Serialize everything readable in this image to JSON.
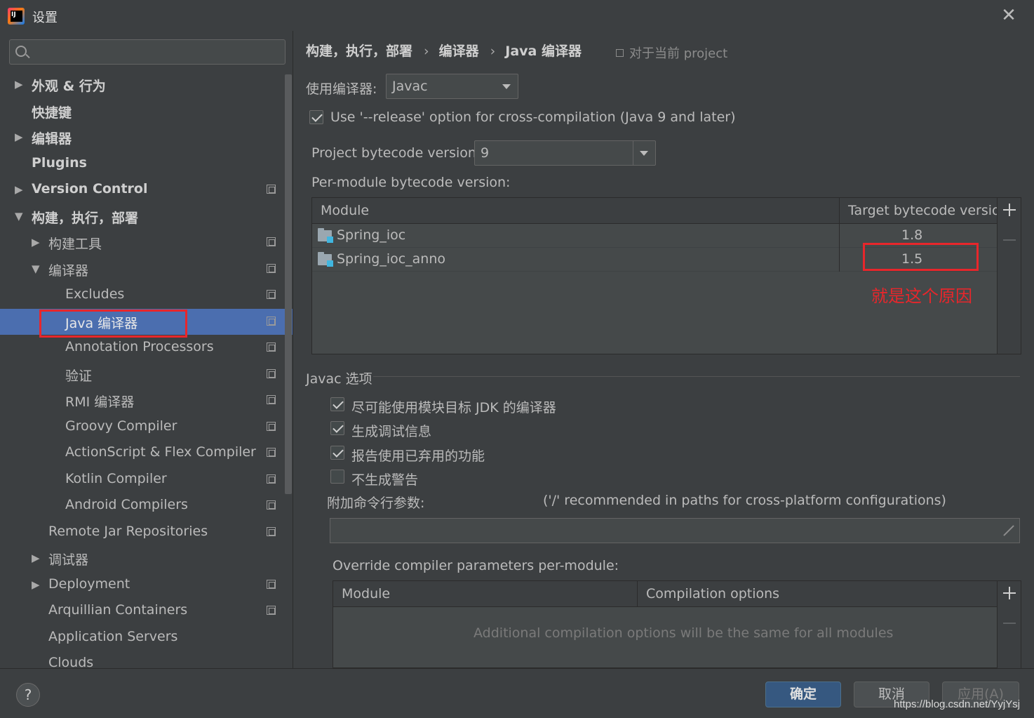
{
  "window": {
    "title": "设置"
  },
  "sidebar": {
    "search": {
      "value": "",
      "placeholder": ""
    },
    "items": [
      {
        "label": "外观 & 行为",
        "level": 0,
        "arrow": "right",
        "bold": true,
        "page_icon": false
      },
      {
        "label": "快捷键",
        "level": 0,
        "arrow": "",
        "bold": true,
        "page_icon": false
      },
      {
        "label": "编辑器",
        "level": 0,
        "arrow": "right",
        "bold": true,
        "page_icon": false
      },
      {
        "label": "Plugins",
        "level": 0,
        "arrow": "",
        "bold": true,
        "page_icon": false
      },
      {
        "label": "Version Control",
        "level": 0,
        "arrow": "right",
        "bold": true,
        "page_icon": true
      },
      {
        "label": "构建，执行，部署",
        "level": 0,
        "arrow": "down",
        "bold": true,
        "page_icon": false
      },
      {
        "label": "构建工具",
        "level": 1,
        "arrow": "right",
        "bold": false,
        "page_icon": true
      },
      {
        "label": "编译器",
        "level": 1,
        "arrow": "down",
        "bold": false,
        "page_icon": true
      },
      {
        "label": "Excludes",
        "level": 2,
        "arrow": "",
        "bold": false,
        "page_icon": true
      },
      {
        "label": "Java 编译器",
        "level": 2,
        "arrow": "",
        "bold": false,
        "page_icon": true,
        "selected": true
      },
      {
        "label": "Annotation Processors",
        "level": 2,
        "arrow": "",
        "bold": false,
        "page_icon": true
      },
      {
        "label": "验证",
        "level": 2,
        "arrow": "",
        "bold": false,
        "page_icon": true
      },
      {
        "label": "RMI 编译器",
        "level": 2,
        "arrow": "",
        "bold": false,
        "page_icon": true
      },
      {
        "label": "Groovy Compiler",
        "level": 2,
        "arrow": "",
        "bold": false,
        "page_icon": true
      },
      {
        "label": "ActionScript & Flex Compiler",
        "level": 2,
        "arrow": "",
        "bold": false,
        "page_icon": true
      },
      {
        "label": "Kotlin Compiler",
        "level": 2,
        "arrow": "",
        "bold": false,
        "page_icon": true
      },
      {
        "label": "Android Compilers",
        "level": 2,
        "arrow": "",
        "bold": false,
        "page_icon": true
      },
      {
        "label": "Remote Jar Repositories",
        "level": 1,
        "arrow": "",
        "bold": false,
        "page_icon": true
      },
      {
        "label": "调试器",
        "level": 1,
        "arrow": "right",
        "bold": false,
        "page_icon": false
      },
      {
        "label": "Deployment",
        "level": 1,
        "arrow": "right",
        "bold": false,
        "page_icon": true
      },
      {
        "label": "Arquillian Containers",
        "level": 1,
        "arrow": "",
        "bold": false,
        "page_icon": true
      },
      {
        "label": "Application Servers",
        "level": 1,
        "arrow": "",
        "bold": false,
        "page_icon": false
      },
      {
        "label": "Clouds",
        "level": 1,
        "arrow": "",
        "bold": false,
        "page_icon": false
      }
    ]
  },
  "breadcrumb": {
    "parts": [
      "构建，执行，部署",
      "编译器",
      "Java 编译器"
    ],
    "separator": "›",
    "scope": "对于当前 project"
  },
  "compiler": {
    "label": "使用编译器:",
    "value": "Javac",
    "release_option": {
      "label": "Use '--release' option for cross-compilation (Java 9 and later)",
      "checked": true
    },
    "bytecode_label": "Project bytecode version:",
    "bytecode_value": "9",
    "per_module_label": "Per-module bytecode version:"
  },
  "module_table": {
    "headers": [
      "Module",
      "Target bytecode version"
    ],
    "rows": [
      {
        "module": "Spring_ioc",
        "version": "1.8"
      },
      {
        "module": "Spring_ioc_anno",
        "version": "1.5"
      }
    ]
  },
  "annotation": {
    "text": "就是这个原因",
    "color": "#e8262b"
  },
  "javac_options": {
    "title": "Javac 选项",
    "checkboxes": [
      {
        "label": "尽可能使用模块目标 JDK 的编译器",
        "checked": true
      },
      {
        "label": "生成调试信息",
        "checked": true
      },
      {
        "label": "报告使用已弃用的功能",
        "checked": true
      },
      {
        "label": "不生成警告",
        "checked": false
      }
    ],
    "cmd_label": "附加命令行参数:",
    "cmd_hint": "('/' recommended in paths for cross-platform configurations)",
    "cmd_value": ""
  },
  "override": {
    "label": "Override compiler parameters per-module:",
    "headers": [
      "Module",
      "Compilation options"
    ],
    "empty_text": "Additional compilation options will be the same for all modules"
  },
  "buttons": {
    "help": "?",
    "ok": "确定",
    "cancel": "取消",
    "apply": "应用(A)"
  },
  "watermark": "https://blog.csdn.net/YyjYsj",
  "colors": {
    "selection": "#4b6eaf",
    "primary_button": "#365880",
    "highlight_box": "#e8262b"
  }
}
